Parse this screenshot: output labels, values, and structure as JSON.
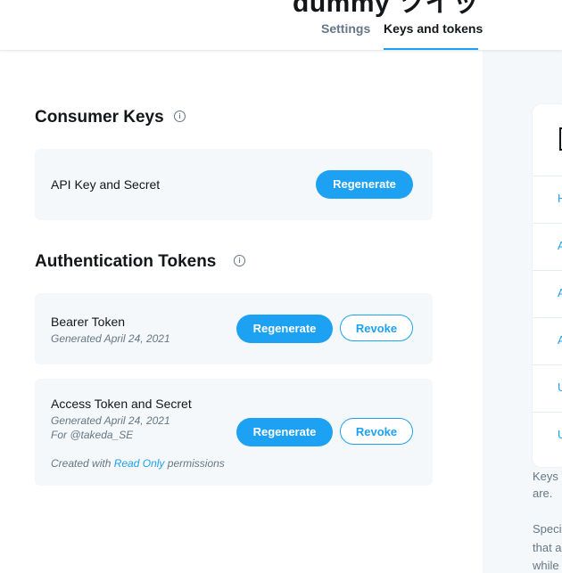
{
  "header": {
    "app_title": "dummy ツイッ",
    "tabs": [
      {
        "label": "Settings",
        "active": false
      },
      {
        "label": "Keys and tokens",
        "active": true
      }
    ]
  },
  "consumer_keys": {
    "title": "Consumer Keys",
    "api_key": {
      "label": "API Key and Secret",
      "regenerate_label": "Regenerate"
    }
  },
  "auth_tokens": {
    "title": "Authentication Tokens",
    "bearer": {
      "label": "Bearer Token",
      "generated": "Generated April 24, 2021",
      "regenerate_label": "Regenerate",
      "revoke_label": "Revoke"
    },
    "access": {
      "label": "Access Token and Secret",
      "generated": "Generated April 24, 2021",
      "for_user": "For @takeda_SE",
      "created_prefix": "Created with",
      "created_link": "Read Only",
      "created_suffix": "permissions",
      "regenerate_label": "Regenerate",
      "revoke_label": "Revoke"
    }
  },
  "sidebar": {
    "rows": [
      "H",
      "A",
      "A",
      "A",
      "U",
      "U"
    ],
    "text_lines": [
      "Keys",
      "are.",
      "Speci",
      "that a",
      "while"
    ]
  },
  "colors": {
    "accent": "#1da1f2",
    "card_bg": "#f5f8fa",
    "muted": "#657786",
    "text": "#14171a"
  }
}
